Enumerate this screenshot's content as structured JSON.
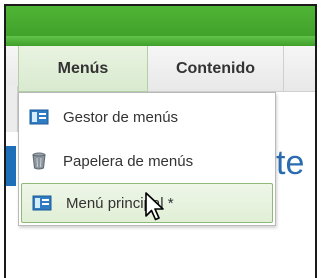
{
  "menubar": {
    "tabs": [
      {
        "label": "Menús",
        "active": true
      },
      {
        "label": "Contenido",
        "active": false
      }
    ]
  },
  "dropdown": {
    "items": [
      {
        "label": "Gestor de menús",
        "icon": "menu-manager-icon",
        "hover": false
      },
      {
        "label": "Papelera de menús",
        "icon": "trash-icon",
        "hover": false
      },
      {
        "label": "Menú principal *",
        "icon": "menu-icon",
        "hover": true
      }
    ]
  },
  "background": {
    "title_fragment": "te"
  },
  "colors": {
    "header_green": "#3d9b27",
    "accent_blue": "#2b6cb0",
    "hover_border": "#8fb879"
  }
}
